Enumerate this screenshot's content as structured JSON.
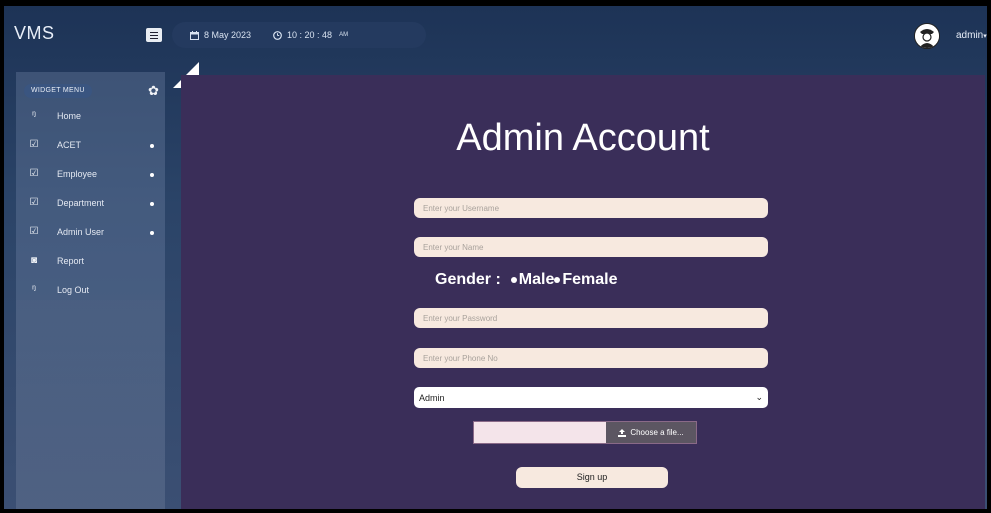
{
  "app": {
    "brand": "VMS"
  },
  "header": {
    "date": "8 May 2023",
    "time": "10 : 20 : 48",
    "ampm": "AM",
    "user": "admin"
  },
  "sidebar": {
    "widget_label": "WIDGET MENU",
    "items": [
      {
        "label": "Home",
        "icon": "feed-icon",
        "has_dot": false
      },
      {
        "label": "ACET",
        "icon": "edit-icon",
        "has_dot": true
      },
      {
        "label": "Employee",
        "icon": "edit-icon",
        "has_dot": true
      },
      {
        "label": "Department",
        "icon": "edit-icon",
        "has_dot": true
      },
      {
        "label": "Admin User",
        "icon": "edit-icon",
        "has_dot": true
      },
      {
        "label": "Report",
        "icon": "camera-icon",
        "has_dot": false
      },
      {
        "label": "Log Out",
        "icon": "feed-icon",
        "has_dot": false
      }
    ]
  },
  "form": {
    "title": "Admin Account",
    "username_placeholder": "Enter your Username",
    "name_placeholder": "Enter your Name",
    "gender_label": "Gender :",
    "gender_options": [
      "Male",
      "Female"
    ],
    "password_placeholder": "Enter your Password",
    "phone_placeholder": "Enter your Phone No",
    "role_selected": "Admin",
    "file_button": "Choose a file...",
    "submit_label": "Sign up"
  },
  "colors": {
    "panel": "#3a2e59",
    "field": "#f7e9df",
    "topbar": "#1d3356"
  }
}
